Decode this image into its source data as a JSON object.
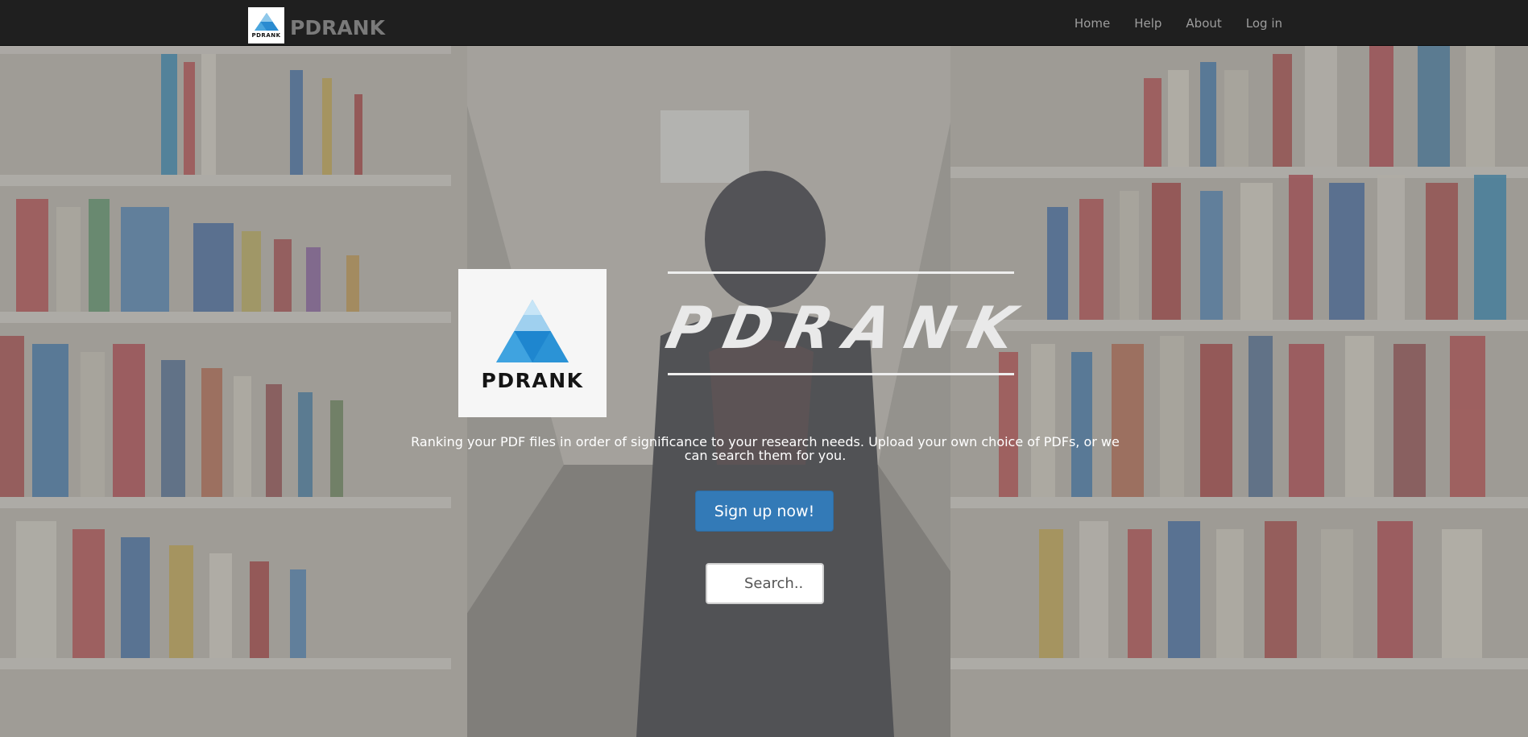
{
  "navbar": {
    "brand_logo_text": "PDRANK",
    "brand_name": "PDRANK",
    "links": [
      "Home",
      "Help",
      "About",
      "Log in"
    ],
    "background": "#1f1f1f"
  },
  "hero": {
    "logo_text": "PDRANK",
    "title": "PDRANK",
    "tagline": "Ranking your PDF files in order of significance to your research needs. Upload your own choice of PDFs, or we can search them for you.",
    "signup_label": "Sign up now!",
    "search_placeholder": "Search..",
    "accent": "#337ab7"
  }
}
